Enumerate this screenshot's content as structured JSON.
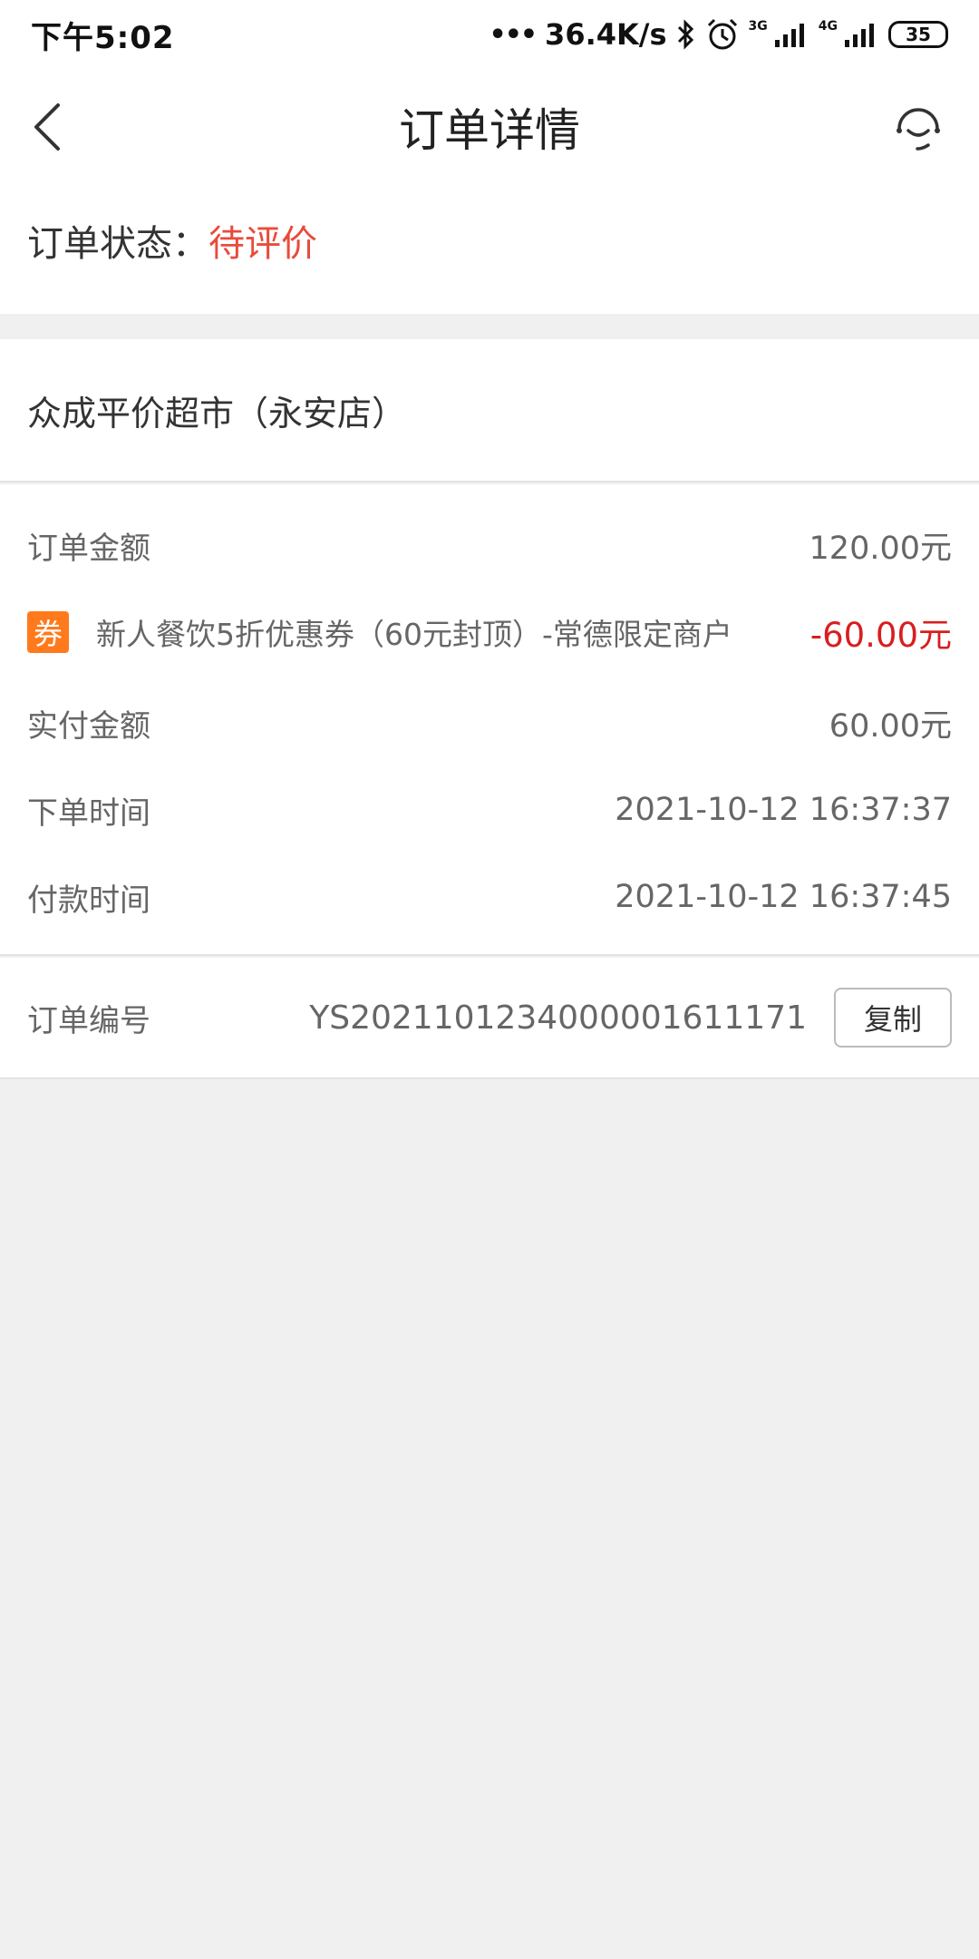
{
  "status_bar": {
    "time": "下午5:02",
    "dots": "•••",
    "net_speed": "36.4K/s",
    "sim1": "3G",
    "sim2": "4G",
    "battery": "35"
  },
  "nav": {
    "title": "订单详情",
    "back_icon": "chevron-left-icon",
    "service_icon": "customer-service-icon"
  },
  "order_status": {
    "label": "订单状态：",
    "value": "待评价",
    "value_color": "#e94b3c"
  },
  "store": {
    "name": "众成平价超市（永安店）"
  },
  "details": {
    "order_amount_label": "订单金额",
    "order_amount_value": "120.00元",
    "coupon_tag": "券",
    "coupon_name": "新人餐饮5折优惠券（60元封顶）-常德限定商户",
    "coupon_value": "-60.00元",
    "paid_amount_label": "实付金额",
    "paid_amount_value": "60.00元",
    "order_time_label": "下单时间",
    "order_time_value": "2021-10-12 16:37:37",
    "pay_time_label": "付款时间",
    "pay_time_value": "2021-10-12 16:37:45"
  },
  "order_number": {
    "label": "订单编号",
    "value": "YS2021101234000001611171",
    "copy_label": "复制"
  },
  "colors": {
    "accent_red": "#d81e1e",
    "coupon_orange": "#ff7a1c",
    "background": "#f0f0f0"
  }
}
